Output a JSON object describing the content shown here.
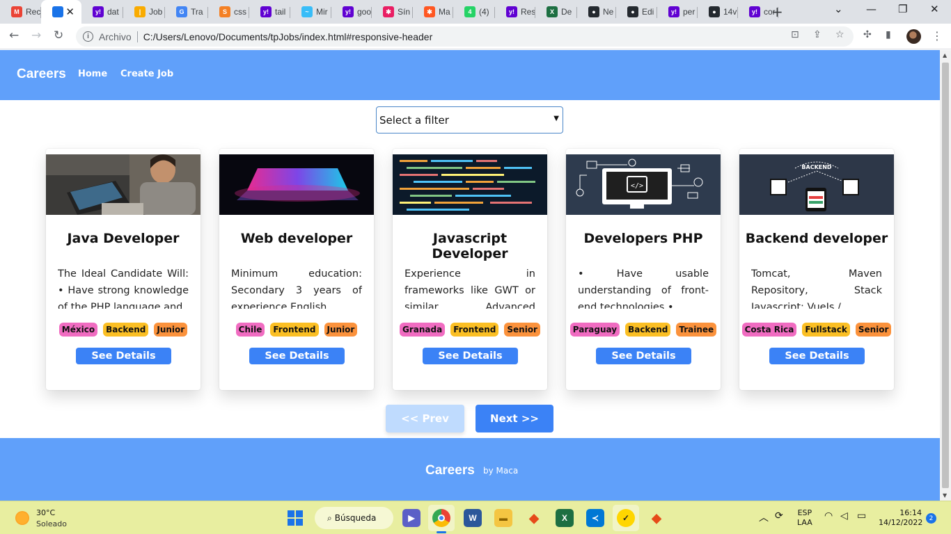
{
  "browser": {
    "tabs": [
      {
        "label": "Rec",
        "icon": "gmail-icon",
        "color": "#ea4335",
        "glyph": "M"
      },
      {
        "label": "",
        "icon": "site-icon",
        "color": "#1a73e8",
        "glyph": "",
        "active": true
      },
      {
        "label": "dat",
        "icon": "yahoo-icon",
        "color": "#6001d2",
        "glyph": "y!"
      },
      {
        "label": "Job",
        "icon": "bars-icon",
        "color": "#f9ab00",
        "glyph": "|"
      },
      {
        "label": "Tra",
        "icon": "translate-icon",
        "color": "#4285f4",
        "glyph": "G"
      },
      {
        "label": "css",
        "icon": "stackoverflow-icon",
        "color": "#f48024",
        "glyph": "S"
      },
      {
        "label": "tail",
        "icon": "yahoo-icon",
        "color": "#6001d2",
        "glyph": "y!"
      },
      {
        "label": "Mir",
        "icon": "tailwind-icon",
        "color": "#38bdf8",
        "glyph": "~"
      },
      {
        "label": "goo",
        "icon": "yahoo-icon",
        "color": "#6001d2",
        "glyph": "y!"
      },
      {
        "label": "Sín",
        "icon": "colorful-icon",
        "color": "#e91e63",
        "glyph": "✱"
      },
      {
        "label": "Ma",
        "icon": "colorful-icon",
        "color": "#ff5722",
        "glyph": "✱"
      },
      {
        "label": "(4)",
        "icon": "whatsapp-icon",
        "color": "#25d366",
        "glyph": "4"
      },
      {
        "label": "Res",
        "icon": "yahoo-icon",
        "color": "#6001d2",
        "glyph": "y!"
      },
      {
        "label": "De",
        "icon": "excel-icon",
        "color": "#1d6f42",
        "glyph": "X"
      },
      {
        "label": "Ne",
        "icon": "github-icon",
        "color": "#24292f",
        "glyph": "●"
      },
      {
        "label": "Edi",
        "icon": "github-icon",
        "color": "#24292f",
        "glyph": "●"
      },
      {
        "label": "per",
        "icon": "yahoo-icon",
        "color": "#6001d2",
        "glyph": "y!"
      },
      {
        "label": "14v",
        "icon": "github-icon",
        "color": "#24292f",
        "glyph": "●"
      },
      {
        "label": "cor",
        "icon": "yahoo-icon",
        "color": "#6001d2",
        "glyph": "y!"
      }
    ],
    "new_tab": "+",
    "address": {
      "scheme": "Archivo",
      "url": "C:/Users/Lenovo/Documents/tpJobs/index.html#responsive-header"
    }
  },
  "site": {
    "brand": "Careers",
    "nav": {
      "home": "Home",
      "create_job": "Create Job"
    },
    "filter": {
      "selected": "Select a filter"
    },
    "colors": {
      "header": "#60a0fa",
      "button": "#3b82f6",
      "country_tag": "#f06cc1",
      "area_tag": "#fbbf24",
      "level_tag": "#fb923c"
    },
    "jobs": [
      {
        "title": "Java Developer",
        "description": "The Ideal Candidate Will: • Have strong knowledge of the PHP language and",
        "location": "México",
        "category": "Backend",
        "seniority": "Junior",
        "details_label": "See Details",
        "image": "laptop-photo"
      },
      {
        "title": "Web developer",
        "description": "Minimum education: Secondary 3 years of experience English",
        "location": "Chile",
        "category": "Frontend",
        "seniority": "Junior",
        "details_label": "See Details",
        "image": "neon-laptop-photo"
      },
      {
        "title": "Javascript Developer",
        "description": "Experience in frameworks like GWT or similar. Advanced knowledge of",
        "location": "Granada",
        "category": "Frontend",
        "seniority": "Senior",
        "details_label": "See Details",
        "image": "code-screen-photo"
      },
      {
        "title": "Developers PHP",
        "description": "• Have usable understanding of front-end technologies •",
        "location": "Paraguay",
        "category": "Backend",
        "seniority": "Trainee",
        "details_label": "See Details",
        "image": "code-monitor-illustration"
      },
      {
        "title": "Backend developer",
        "description": "Tomcat, Maven Repository, Stack Javascript: VueJs /",
        "location": "Costa Rica",
        "category": "Fullstack",
        "seniority": "Senior",
        "details_label": "See Details",
        "image": "backend-diagram-illustration"
      }
    ],
    "pagination": {
      "prev": "<< Prev",
      "next": "Next >>"
    },
    "footer": {
      "brand": "Careers",
      "by": "by Maca"
    }
  },
  "taskbar": {
    "weather": {
      "temp": "30°C",
      "condition": "Soleado"
    },
    "search_label": "Búsqueda",
    "lang": {
      "line1": "ESP",
      "line2": "LAA"
    },
    "clock": {
      "time": "16:14",
      "date": "14/12/2022"
    },
    "notifications": "2"
  }
}
